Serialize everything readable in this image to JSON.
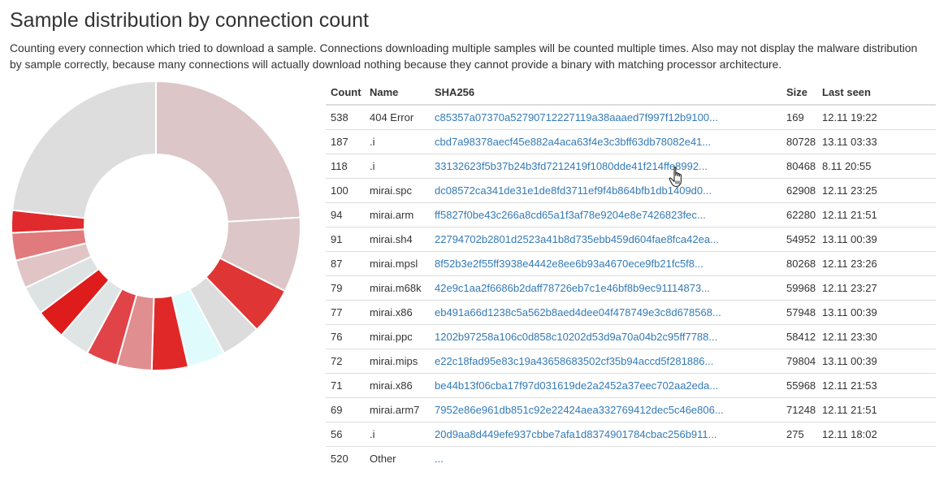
{
  "page": {
    "title": "Sample distribution by connection count",
    "description": "Counting every connection which tried to download a sample. Connections downloading multiple samples will be counted multiple times. Also may not display the malware distribution by sample correctly, because many connections will actually download nothing because they cannot provide a binary with matching processor architecture."
  },
  "table": {
    "headers": {
      "count": "Count",
      "name": "Name",
      "sha256": "SHA256",
      "size": "Size",
      "last_seen": "Last seen"
    },
    "rows": [
      {
        "count": "538",
        "name": "404 Error",
        "sha256": "c85357a07370a52790712227119a38aaaed7f997f12b9100...",
        "size": "169",
        "last_seen": "12.11 19:22"
      },
      {
        "count": "187",
        "name": ".i",
        "sha256": "cbd7a98378aecf45e882a4aca63f4e3c3bff63db78082e41...",
        "size": "80728",
        "last_seen": "13.11 03:33"
      },
      {
        "count": "118",
        "name": ".i",
        "sha256": "33132623f5b37b24b3fd7212419f1080dde41f214ffe8992...",
        "size": "80468",
        "last_seen": "8.11 20:55"
      },
      {
        "count": "100",
        "name": "mirai.spc",
        "sha256": "dc08572ca341de31e1de8fd3711ef9f4b864bfb1db1409d0...",
        "size": "62908",
        "last_seen": "12.11 23:25"
      },
      {
        "count": "94",
        "name": "mirai.arm",
        "sha256": "ff5827f0be43c266a8cd65a1f3af78e9204e8e7426823fec...",
        "size": "62280",
        "last_seen": "12.11 21:51"
      },
      {
        "count": "91",
        "name": "mirai.sh4",
        "sha256": "22794702b2801d2523a41b8d735ebb459d604fae8fca42ea...",
        "size": "54952",
        "last_seen": "13.11 00:39"
      },
      {
        "count": "87",
        "name": "mirai.mpsl",
        "sha256": "8f52b3e2f55ff3938e4442e8ee6b93a4670ece9fb21fc5f8...",
        "size": "80268",
        "last_seen": "12.11 23:26"
      },
      {
        "count": "79",
        "name": "mirai.m68k",
        "sha256": "42e9c1aa2f6686b2daff78726eb7c1e46bf8b9ec91114873...",
        "size": "59968",
        "last_seen": "12.11 23:27"
      },
      {
        "count": "77",
        "name": "mirai.x86",
        "sha256": "eb491a66d1238c5a562b8aed4dee04f478749e3c8d678568...",
        "size": "57948",
        "last_seen": "13.11 00:39"
      },
      {
        "count": "76",
        "name": "mirai.ppc",
        "sha256": "1202b97258a106c0d858c10202d53d9a70a04b2c95ff7788...",
        "size": "58412",
        "last_seen": "12.11 23:30"
      },
      {
        "count": "72",
        "name": "mirai.mips",
        "sha256": "e22c18fad95e83c19a43658683502cf35b94accd5f281886...",
        "size": "79804",
        "last_seen": "13.11 00:39"
      },
      {
        "count": "71",
        "name": "mirai.x86",
        "sha256": "be44b13f06cba17f97d031619de2a2452a37eec702aa2eda...",
        "size": "55968",
        "last_seen": "12.11 21:53"
      },
      {
        "count": "69",
        "name": "mirai.arm7",
        "sha256": "7952e86e961db851c92e22424aea332769412dec5c46e806...",
        "size": "71248",
        "last_seen": "12.11 21:51"
      },
      {
        "count": "56",
        "name": ".i",
        "sha256": "20d9aa8d449efe937cbbe7afa1d8374901784cbac256b911...",
        "size": "275",
        "last_seen": "12.11 18:02"
      },
      {
        "count": "520",
        "name": "Other",
        "sha256": "...",
        "size": "",
        "last_seen": ""
      }
    ]
  },
  "chart_data": {
    "type": "pie",
    "style": "donut",
    "categories": [
      "404 Error",
      ".i",
      ".i",
      "mirai.spc",
      "mirai.arm",
      "mirai.sh4",
      "mirai.mpsl",
      "mirai.m68k",
      "mirai.x86",
      "mirai.ppc",
      "mirai.mips",
      "mirai.x86",
      "mirai.arm7",
      ".i",
      "Other"
    ],
    "values": [
      538,
      187,
      118,
      100,
      94,
      91,
      87,
      79,
      77,
      76,
      72,
      71,
      69,
      56,
      520
    ],
    "colors": [
      "#dcc6c7",
      "#dcc6c7",
      "#e03535",
      "#dcdcdc",
      "#e0fbfb",
      "#e02828",
      "#e08e90",
      "#e04448",
      "#dfe4e4",
      "#de1c1c",
      "#dde2e2",
      "#e0c4c6",
      "#e07a7c",
      "#e02a2d",
      "#dddddd"
    ],
    "legend": "none"
  },
  "cursor": {
    "icon": "hand-pointer-icon"
  }
}
